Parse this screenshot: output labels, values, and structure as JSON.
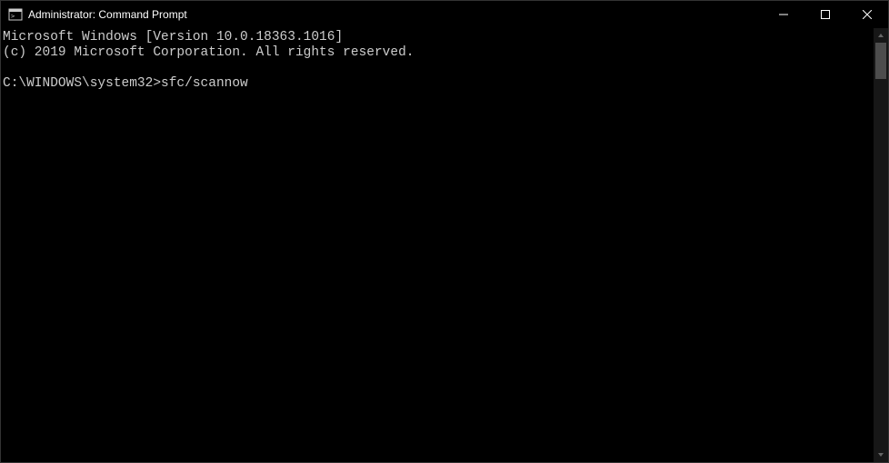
{
  "window": {
    "title": "Administrator: Command Prompt"
  },
  "terminal": {
    "line1": "Microsoft Windows [Version 10.0.18363.1016]",
    "line2": "(c) 2019 Microsoft Corporation. All rights reserved.",
    "blank": "",
    "prompt": "C:\\WINDOWS\\system32>",
    "command": "sfc/scannow"
  }
}
